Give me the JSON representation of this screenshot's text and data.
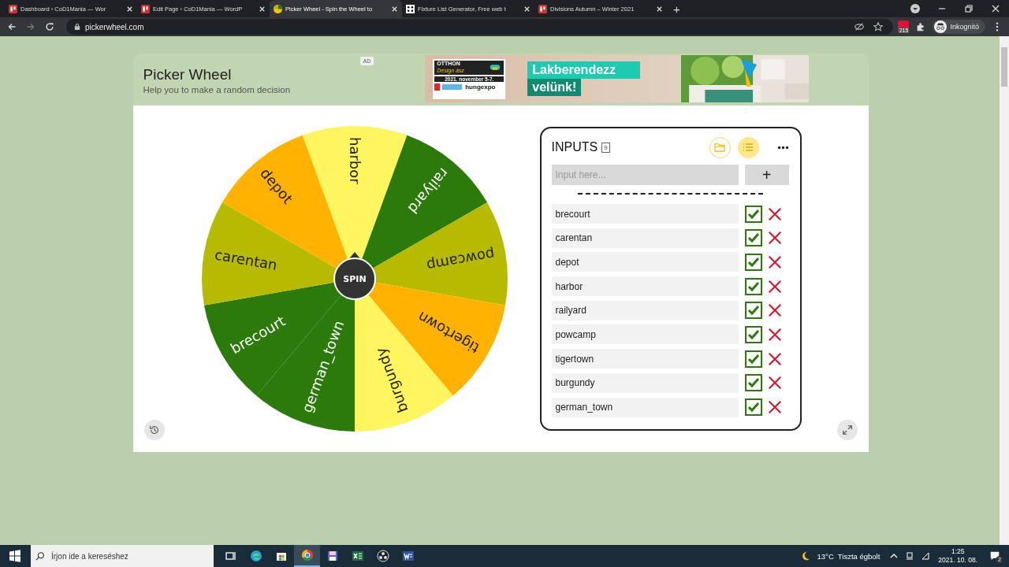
{
  "browser": {
    "tabs": [
      {
        "title": "Dashboard ‹ CoD1Mania — Wor",
        "kind": "site",
        "selected": false
      },
      {
        "title": "Edit Page ‹ CoD1Mania — WordP",
        "kind": "site",
        "selected": false
      },
      {
        "title": "Picker Wheel - Spin the Wheel to",
        "kind": "wheel",
        "selected": true
      },
      {
        "title": "Fixture List Generator, Free web t",
        "kind": "dice",
        "selected": false
      },
      {
        "title": "Divisions Autumn – Winter 2021",
        "kind": "site",
        "selected": false
      }
    ],
    "new_tab": "+",
    "address": "pickerwheel.com",
    "extension_badge": "215",
    "profile": "Inkognitó"
  },
  "page": {
    "title": "Picker Wheel",
    "subtitle": "Help you to make a random decision",
    "ad": {
      "label": "AD",
      "logo_lines": [
        "OTTHON",
        "Design ász"
      ],
      "date": "2021. november 5-7.",
      "brand": "hungexpo",
      "headline": [
        "Lakberendezz",
        "velünk!"
      ]
    }
  },
  "wheel": {
    "center_label": "SPIN",
    "slices": [
      {
        "label": "harbor",
        "color": "#fff55e"
      },
      {
        "label": "railyard",
        "color": "#2b7a0b"
      },
      {
        "label": "powcamp",
        "color": "#b6bb00"
      },
      {
        "label": "tigertown",
        "color": "#ffb300"
      },
      {
        "label": "burgundy",
        "color": "#fff55e"
      },
      {
        "label": "german_town",
        "color": "#2b7a0b"
      },
      {
        "label": "brecourt",
        "color": "#2b7a0b"
      },
      {
        "label": "carentan",
        "color": "#b6bb00"
      },
      {
        "label": "depot",
        "color": "#ffb300"
      }
    ]
  },
  "inputs": {
    "title": "INPUTS",
    "count": "9",
    "placeholder": "Input here...",
    "add_label": "+",
    "items": [
      {
        "label": "brecourt",
        "checked": true
      },
      {
        "label": "carentan",
        "checked": true
      },
      {
        "label": "depot",
        "checked": true
      },
      {
        "label": "harbor",
        "checked": true
      },
      {
        "label": "railyard",
        "checked": true
      },
      {
        "label": "powcamp",
        "checked": true
      },
      {
        "label": "tigertown",
        "checked": true
      },
      {
        "label": "burgundy",
        "checked": true
      },
      {
        "label": "german_town",
        "checked": true
      }
    ]
  },
  "taskbar": {
    "search_placeholder": "Írjon ide a kereséshez",
    "weather": "13°C  Tiszta égbolt",
    "time": "1:25",
    "date": "2021. 10. 08.",
    "notifications": "2"
  }
}
